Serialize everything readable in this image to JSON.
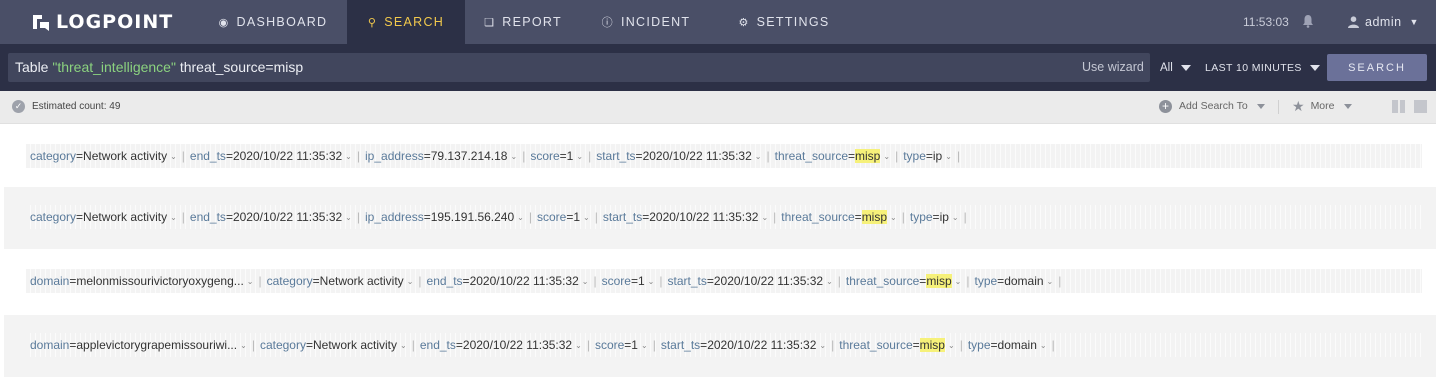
{
  "app": {
    "logo_text": "LOGPOINT"
  },
  "nav": {
    "items": [
      {
        "label": "DASHBOARD",
        "icon": "dashboard-icon"
      },
      {
        "label": "SEARCH",
        "icon": "search-icon",
        "active": true
      },
      {
        "label": "REPORT",
        "icon": "report-icon"
      },
      {
        "label": "INCIDENT",
        "icon": "incident-icon"
      },
      {
        "label": "SETTINGS",
        "icon": "settings-icon"
      }
    ],
    "time": "11:53:03",
    "user": "admin"
  },
  "search": {
    "query_prefix": "Table ",
    "query_string": "\"threat_intelligence\"",
    "query_suffix": " threat_source=misp",
    "wizard_label": "Use wizard",
    "repo_selected": "All",
    "time_range": "LAST 10 MINUTES",
    "button_label": "SEARCH"
  },
  "info": {
    "estimated_count": "Estimated count: 49",
    "add_search_to": "Add Search To",
    "more": "More"
  },
  "results": [
    {
      "fields": [
        {
          "key": "category",
          "value": "Network activity"
        },
        {
          "key": "end_ts",
          "value": "2020/10/22 11:35:32"
        },
        {
          "key": "ip_address",
          "value": "79.137.214.18"
        },
        {
          "key": "score",
          "value": "1"
        },
        {
          "key": "start_ts",
          "value": "2020/10/22 11:35:32"
        },
        {
          "key": "threat_source",
          "value": "misp"
        },
        {
          "key": "type",
          "value": "ip"
        }
      ]
    },
    {
      "fields": [
        {
          "key": "category",
          "value": "Network activity"
        },
        {
          "key": "end_ts",
          "value": "2020/10/22 11:35:32"
        },
        {
          "key": "ip_address",
          "value": "195.191.56.240"
        },
        {
          "key": "score",
          "value": "1"
        },
        {
          "key": "start_ts",
          "value": "2020/10/22 11:35:32"
        },
        {
          "key": "threat_source",
          "value": "misp"
        },
        {
          "key": "type",
          "value": "ip"
        }
      ]
    },
    {
      "fields": [
        {
          "key": "domain",
          "value": "melonmissourivictoryoxygeng..."
        },
        {
          "key": "category",
          "value": "Network activity"
        },
        {
          "key": "end_ts",
          "value": "2020/10/22 11:35:32"
        },
        {
          "key": "score",
          "value": "1"
        },
        {
          "key": "start_ts",
          "value": "2020/10/22 11:35:32"
        },
        {
          "key": "threat_source",
          "value": "misp"
        },
        {
          "key": "type",
          "value": "domain"
        }
      ]
    },
    {
      "fields": [
        {
          "key": "domain",
          "value": "applevictorygrapemissouriwi..."
        },
        {
          "key": "category",
          "value": "Network activity"
        },
        {
          "key": "end_ts",
          "value": "2020/10/22 11:35:32"
        },
        {
          "key": "score",
          "value": "1"
        },
        {
          "key": "start_ts",
          "value": "2020/10/22 11:35:32"
        },
        {
          "key": "threat_source",
          "value": "misp"
        },
        {
          "key": "type",
          "value": "domain"
        }
      ]
    }
  ],
  "highlight_term": "misp",
  "colors": {
    "nav_bg": "#4a4f67",
    "active_bg": "#2c3046",
    "active_text": "#f2c94c",
    "query_string": "#8bd27f",
    "field_key": "#5a7a9a",
    "highlight": "#f6f17a",
    "search_button": "#6b7199"
  }
}
